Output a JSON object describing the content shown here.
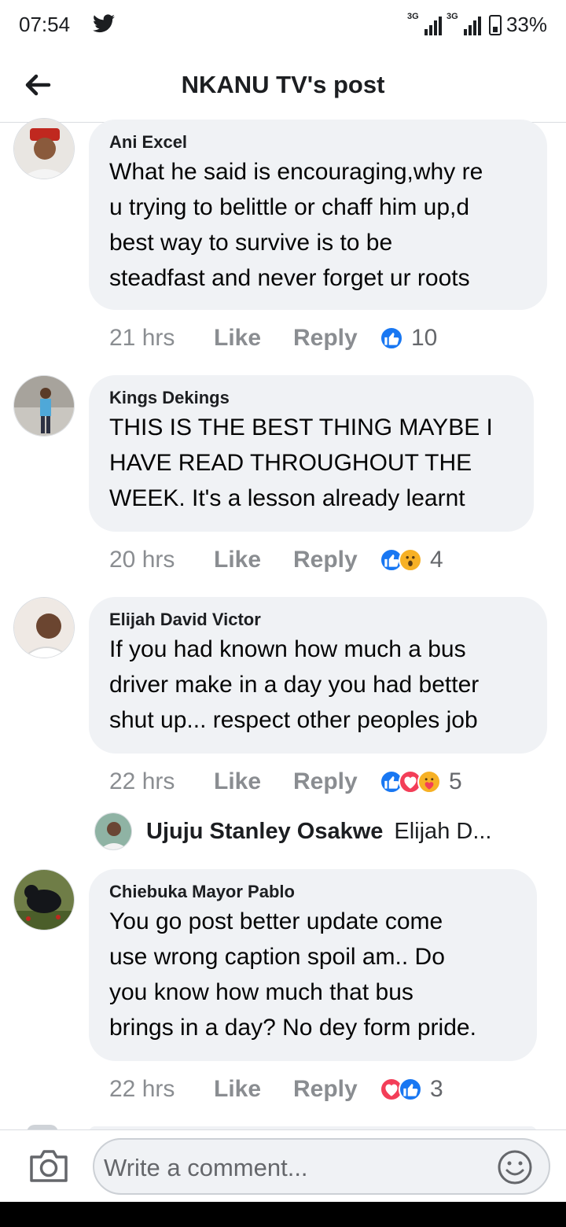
{
  "status_bar": {
    "time": "07:54",
    "network1": "3G",
    "network2": "3G",
    "battery": "33%"
  },
  "header": {
    "title": "NKANU TV's post"
  },
  "comments": [
    {
      "author": "Ani Excel",
      "text": "What he said is encouraging,why re\nu trying to belittle or chaff him up,d\nbest way to survive is to be\nsteadfast and never forget ur roots",
      "time": "21 hrs",
      "like": "Like",
      "reply": "Reply",
      "reactions": [
        "like"
      ],
      "count": "10"
    },
    {
      "author": "Kings Dekings",
      "text": "THIS IS THE BEST THING MAYBE I\nHAVE READ THROUGHOUT THE\nWEEK. It's a lesson already learnt",
      "time": "20 hrs",
      "like": "Like",
      "reply": "Reply",
      "reactions": [
        "like",
        "wow"
      ],
      "count": "4"
    },
    {
      "author": "Elijah David Victor",
      "text": "If you had known how much a bus\ndriver make in a day you had better\nshut up... respect other peoples job",
      "time": "22 hrs",
      "like": "Like",
      "reply": "Reply",
      "reactions": [
        "like",
        "love",
        "care"
      ],
      "count": "5"
    },
    {
      "author": "Chiebuka Mayor Pablo",
      "text": "You go post better update come\nuse wrong caption spoil am.. Do\nyou know how much that bus\nbrings in a day? No dey form pride.",
      "time": "22 hrs",
      "like": "Like",
      "reply": "Reply",
      "reactions": [
        "love",
        "like"
      ],
      "count": "3"
    }
  ],
  "reply_preview": {
    "author": "Ujuju Stanley Osakwe",
    "snippet": "Elijah D..."
  },
  "composer": {
    "placeholder": "Write a comment..."
  },
  "colors": {
    "bubble": "#f0f2f5",
    "like_blue": "#1877f2",
    "love_red": "#f33e58",
    "muted_text": "#8a8d91"
  }
}
